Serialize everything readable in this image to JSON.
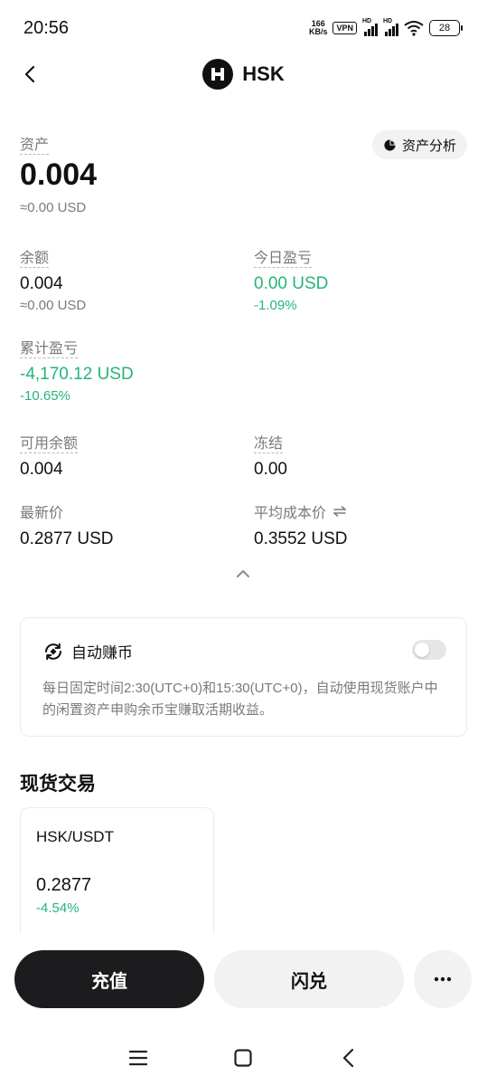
{
  "status_bar": {
    "time": "20:56",
    "net_speed_value": "166",
    "net_speed_unit": "KB/s",
    "vpn_label": "VPN",
    "hd_label": "HD",
    "battery": "28",
    "icons": [
      "wifi-icon",
      "signal-icon",
      "battery-icon"
    ]
  },
  "header": {
    "title": "HSK",
    "back_icon": "chevron-left-icon",
    "logo_icon": "hsk-logo-icon"
  },
  "asset": {
    "label": "资产",
    "value": "0.004",
    "usd": "≈0.00 USD",
    "analysis_button": "资产分析",
    "analysis_icon": "pie-chart-icon"
  },
  "stats": {
    "balance": {
      "label": "余额",
      "value": "0.004",
      "sub": "≈0.00 USD"
    },
    "today_pnl": {
      "label": "今日盈亏",
      "value": "0.00 USD",
      "sub": "-1.09%"
    },
    "total_pnl": {
      "label": "累计盈亏",
      "value": "-4,170.12 USD",
      "sub": "-10.65%"
    },
    "available": {
      "label": "可用余额",
      "value": "0.004"
    },
    "frozen": {
      "label": "冻结",
      "value": "0.00"
    },
    "latest_price": {
      "label": "最新价",
      "value": "0.2877 USD"
    },
    "avg_cost": {
      "label": "平均成本价",
      "value": "0.3552 USD",
      "icon": "swap-arrows-icon"
    }
  },
  "collapse_icon": "chevron-up-icon",
  "auto_earn": {
    "title": "自动赚币",
    "icon": "auto-earn-icon",
    "enabled": false,
    "description": "每日固定时间2:30(UTC+0)和15:30(UTC+0)，自动使用现货账户中的闲置资产申购余币宝赚取活期收益。"
  },
  "spot": {
    "section_title": "现货交易",
    "pairs": [
      {
        "name": "HSK/USDT",
        "price": "0.2877",
        "change": "-4.54%"
      }
    ]
  },
  "actions": {
    "deposit": "充值",
    "swap": "闪兑",
    "more_icon": "more-dots-icon"
  },
  "system_nav": [
    "menu-icon",
    "home-icon",
    "back-icon"
  ],
  "colors": {
    "positive_green": "#26b47a",
    "primary_dark": "#1c1c1e",
    "muted_gray": "#7a7a7a",
    "light_bg": "#f2f2f2"
  }
}
